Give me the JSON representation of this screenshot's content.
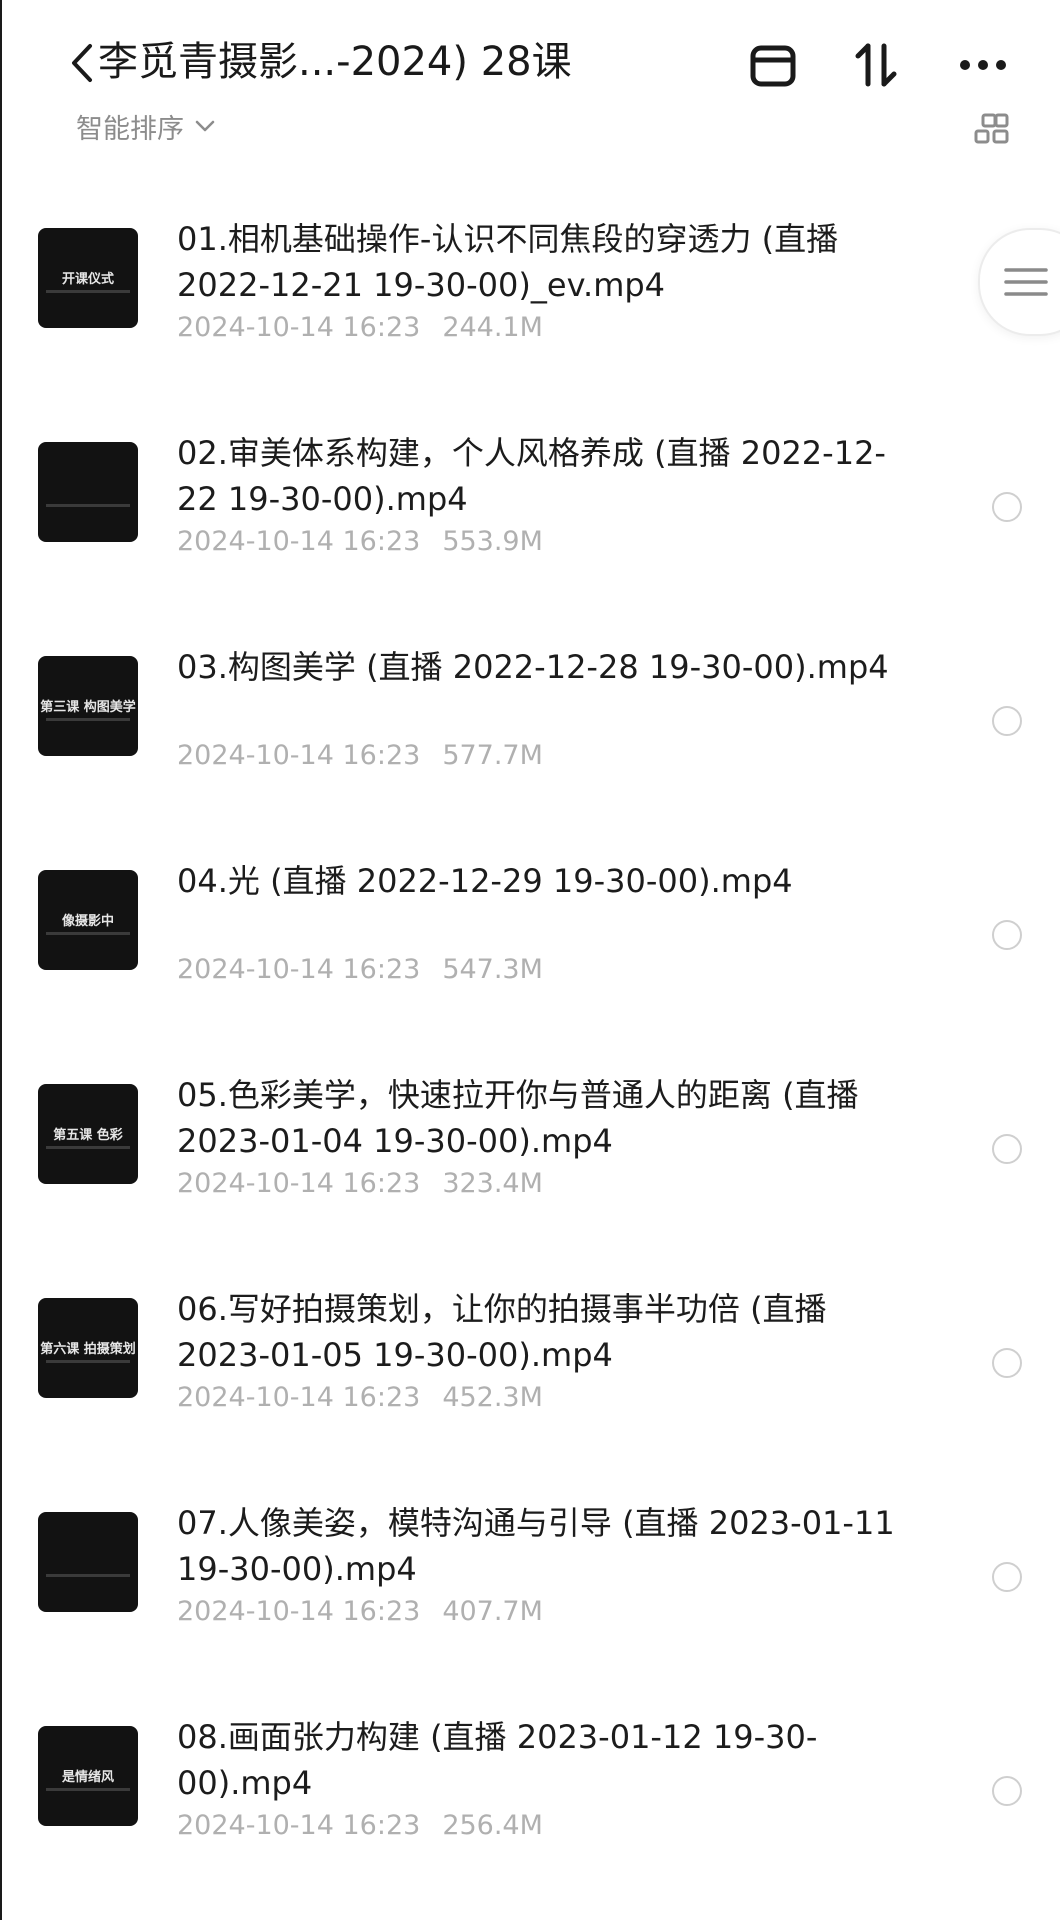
{
  "header": {
    "title": "李觅青摄影...-2024) 28课",
    "sort_label": "智能排序",
    "icons": [
      "back-arrow-icon",
      "select-box-icon",
      "sort-icon",
      "more-icon",
      "grid-view-icon",
      "menu-icon"
    ]
  },
  "files": [
    {
      "name": "01.相机基础操作-认识不同焦段的穿透力 (直播 2022-12-21 19-30-00)_ev.mp4",
      "date": "2024-10-14 16:23",
      "size": "244.1M",
      "thumb_text": "开课仪式"
    },
    {
      "name": "02.审美体系构建，个人风格养成 (直播 2022-12-22 19-30-00).mp4",
      "date": "2024-10-14 16:23",
      "size": "553.9M",
      "thumb_text": ""
    },
    {
      "name": "03.构图美学 (直播 2022-12-28 19-30-00).mp4",
      "date": "2024-10-14 16:23",
      "size": "577.7M",
      "thumb_text": "第三课 构图美学"
    },
    {
      "name": "04.光 (直播 2022-12-29 19-30-00).mp4",
      "date": "2024-10-14 16:23",
      "size": "547.3M",
      "thumb_text": "像摄影中"
    },
    {
      "name": "05.色彩美学，快速拉开你与普通人的距离 (直播 2023-01-04 19-30-00).mp4",
      "date": "2024-10-14 16:23",
      "size": "323.4M",
      "thumb_text": "第五课 色彩"
    },
    {
      "name": "06.写好拍摄策划，让你的拍摄事半功倍 (直播 2023-01-05 19-30-00).mp4",
      "date": "2024-10-14 16:23",
      "size": "452.3M",
      "thumb_text": "第六课 拍摄策划"
    },
    {
      "name": "07.人像美姿，模特沟通与引导 (直播 2023-01-11 19-30-00).mp4",
      "date": "2024-10-14 16:23",
      "size": "407.7M",
      "thumb_text": ""
    },
    {
      "name": "08.画面张力构建 (直播 2023-01-12 19-30-00).mp4",
      "date": "2024-10-14 16:23",
      "size": "256.4M",
      "thumb_text": "是情绪风"
    }
  ]
}
